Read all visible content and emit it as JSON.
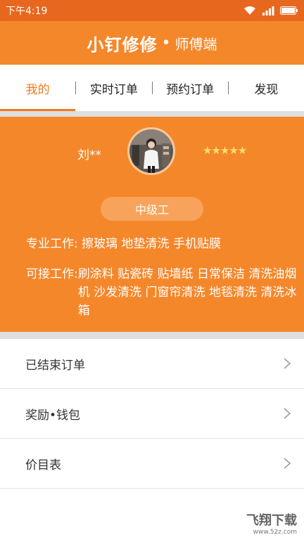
{
  "status_bar": {
    "time": "下午4:19"
  },
  "header": {
    "brand": "小钉修修",
    "separator": "•",
    "subtitle": "师傅端"
  },
  "tabs": [
    {
      "label": "我的"
    },
    {
      "label": "实时订单"
    },
    {
      "label": "预约订单"
    },
    {
      "label": "发现"
    }
  ],
  "profile": {
    "name": "刘**",
    "rating_stars": 5,
    "stars_text": "★★★★★",
    "level": "中级工",
    "professional_label": "专业工作:",
    "professional_values": "擦玻璃 地垫清洗 手机贴膜",
    "available_label": "可接工作:",
    "available_values": "刷涂料 贴瓷砖 贴墙纸 日常保洁 清洗油烟机 沙发清洗 门窗帘清洗 地毯清洗 清洗冰箱"
  },
  "menu": [
    {
      "label": "已结束订单"
    },
    {
      "label": "奖励•钱包"
    },
    {
      "label": "价目表"
    }
  ],
  "watermark": {
    "text": "飞翔下载",
    "url_text": "www.52z.com"
  },
  "colors": {
    "primary": "#f5872b",
    "status_bar": "#e8671e",
    "tab_active": "#f07a22"
  }
}
